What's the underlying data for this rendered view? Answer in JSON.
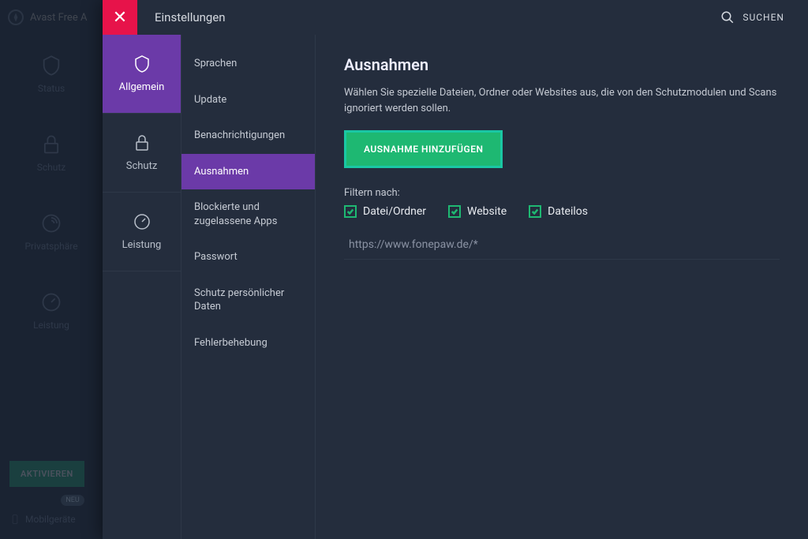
{
  "app": {
    "title_partial": "Avast Free A"
  },
  "left_nav": {
    "items": [
      {
        "label": "Status"
      },
      {
        "label": "Schutz"
      },
      {
        "label": "Privatsphäre"
      },
      {
        "label": "Leistung"
      }
    ],
    "activate": "AKTIVIEREN",
    "neu": "NEU",
    "mobile": "Mobilgeräte"
  },
  "modal": {
    "title": "Einstellungen",
    "search": "SUCHEN"
  },
  "categories": [
    {
      "label": "Allgemein"
    },
    {
      "label": "Schutz"
    },
    {
      "label": "Leistung"
    }
  ],
  "sub_items": [
    {
      "label": "Sprachen"
    },
    {
      "label": "Update"
    },
    {
      "label": "Benachrichtigungen"
    },
    {
      "label": "Ausnahmen"
    },
    {
      "label": "Blockierte und zugelassene Apps"
    },
    {
      "label": "Passwort"
    },
    {
      "label": "Schutz persönlicher Daten"
    },
    {
      "label": "Fehlerbehebung"
    }
  ],
  "content": {
    "heading": "Ausnahmen",
    "description": "Wählen Sie spezielle Dateien, Ordner oder Websites aus, die von den Schutzmodulen und Scans ignoriert werden sollen.",
    "add_button": "AUSNAHME HINZUFÜGEN",
    "filter_label": "Filtern nach:",
    "filters": [
      {
        "label": "Datei/Ordner"
      },
      {
        "label": "Website"
      },
      {
        "label": "Dateilos"
      }
    ],
    "exceptions": [
      {
        "value": "https://www.fonepaw.de/*"
      }
    ]
  }
}
